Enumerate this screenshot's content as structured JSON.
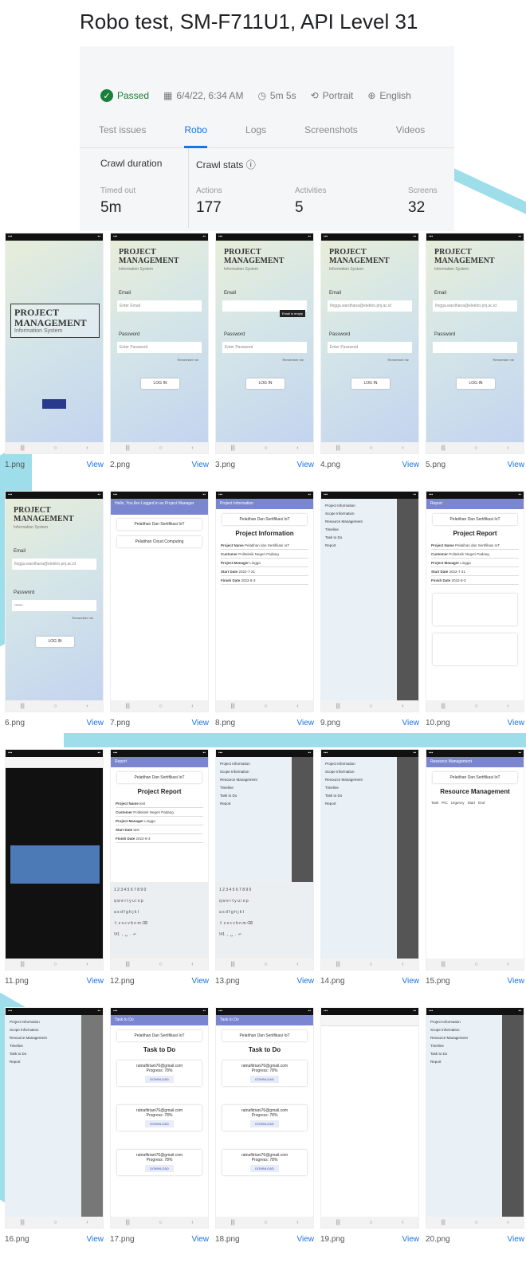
{
  "header": {
    "title": "Robo test, SM-F711U1, API Level 31"
  },
  "status": {
    "result": "Passed",
    "date": "6/4/22, 6:34 AM",
    "duration": "5m 5s",
    "orientation": "Portrait",
    "locale": "English"
  },
  "tabs": [
    "Test issues",
    "Robo",
    "Logs",
    "Screenshots",
    "Videos"
  ],
  "active_tab": "Robo",
  "crawl": {
    "duration_title": "Crawl duration",
    "stats_title": "Crawl stats",
    "duration_label": "Timed out",
    "duration_value": "5m",
    "stats": [
      {
        "label": "Actions",
        "value": "177"
      },
      {
        "label": "Activities",
        "value": "5"
      },
      {
        "label": "Screens",
        "value": "32"
      }
    ]
  },
  "view_label": "View",
  "screenshots": [
    {
      "file": "1.png"
    },
    {
      "file": "2.png"
    },
    {
      "file": "3.png"
    },
    {
      "file": "4.png"
    },
    {
      "file": "5.png"
    },
    {
      "file": "6.png"
    },
    {
      "file": "7.png"
    },
    {
      "file": "8.png"
    },
    {
      "file": "9.png"
    },
    {
      "file": "10.png"
    },
    {
      "file": "11.png"
    },
    {
      "file": "12.png"
    },
    {
      "file": "13.png"
    },
    {
      "file": "14.png"
    },
    {
      "file": "15.png"
    },
    {
      "file": "16.png"
    },
    {
      "file": "17.png"
    },
    {
      "file": "18.png"
    },
    {
      "file": "19.png"
    },
    {
      "file": "20.png"
    }
  ],
  "app": {
    "title1": "PROJECT",
    "title2": "MANAGEMENT",
    "subtitle": "Information System",
    "email_label": "Email",
    "email_placeholder": "Enter Email",
    "email_value": "Ilngga.wardhana@elektro.pnj.ac.id",
    "password_label": "Password",
    "password_placeholder": "Enter Password",
    "password_masked": "••••••",
    "remember": "Remember me",
    "login": "LOG IN",
    "error_tip": "Email is empty",
    "greeting": "Hello, You Are Logged in as Project Manager",
    "project1": "Pelatihan Dan Sertifikasi IoT",
    "project2": "Pelatihan Cloud Computing",
    "project_info_title": "Project Information",
    "report_title": "Report",
    "project_report": "Project Report",
    "fields": {
      "name": "Project Name",
      "name_val": "Pelatihan dan Sertifikasi IoT",
      "customer": "Customer",
      "customer_val": "Politeknik Negeri Padang",
      "manager": "Project Manager",
      "manager_val": "Lingga",
      "start": "Start Date",
      "start_val": "2022-7-21",
      "finish": "Finish Date",
      "finish_val": "2022-8-3",
      "test": "test"
    },
    "menu": [
      "Project Information",
      "Scope Information",
      "Resource Management",
      "Timeline",
      "Task to Do",
      "Report"
    ],
    "resource_title": "Resource Management",
    "resource_cols": [
      "Task",
      "PIC",
      "Urgency",
      "Start",
      "End"
    ],
    "task_title": "Task to Do",
    "task_toolbar": "Task to Do",
    "download": "DOWNLOAD",
    "task_email": "ratnafitriani76@gmail.com",
    "task_progress": "Progress: 78%"
  }
}
